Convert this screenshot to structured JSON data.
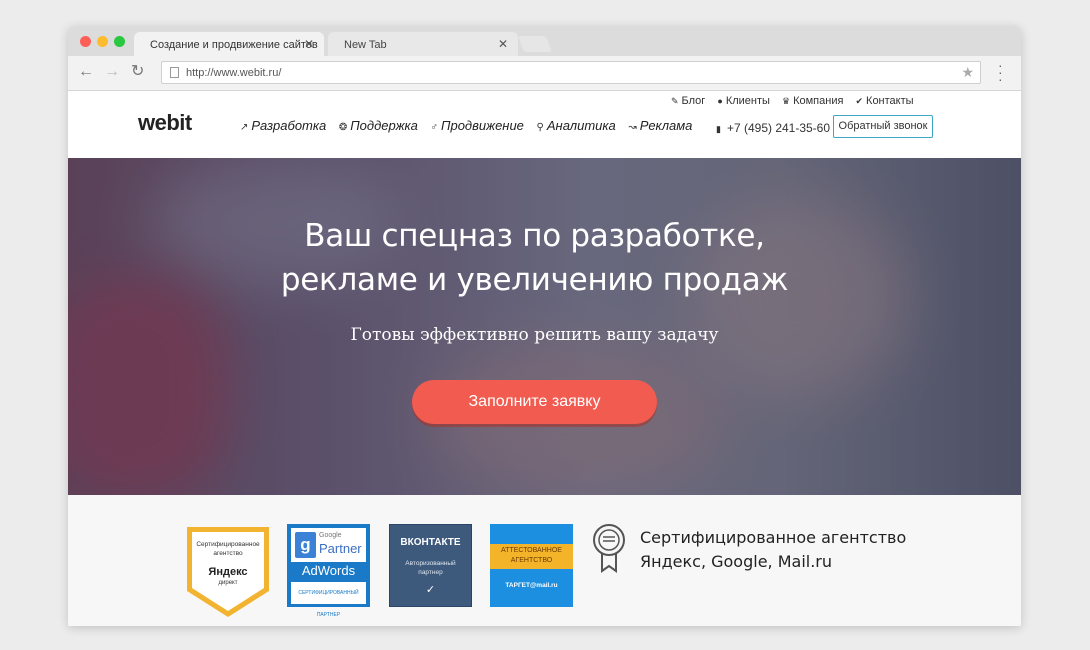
{
  "browser": {
    "tabs": [
      {
        "label": "Создание и продвижение сайтов",
        "active": true
      },
      {
        "label": "New Tab",
        "active": false
      }
    ],
    "url": "http://www.webit.ru/"
  },
  "header": {
    "logo": "webit",
    "main_nav": [
      {
        "label": "Разработка",
        "icon": "cursor-icon"
      },
      {
        "label": "Поддержка",
        "icon": "lifebuoy-icon"
      },
      {
        "label": "Продвижение",
        "icon": "rocket-icon"
      },
      {
        "label": "Аналитика",
        "icon": "magnifier-icon"
      },
      {
        "label": "Реклама",
        "icon": "trend-icon"
      }
    ],
    "top_nav": [
      {
        "label": "Блог",
        "icon": "pencil-icon"
      },
      {
        "label": "Клиенты",
        "icon": "user-icon"
      },
      {
        "label": "Компания",
        "icon": "crown-icon"
      },
      {
        "label": "Контакты",
        "icon": "check-icon"
      }
    ],
    "phone": "+7 (495) 241-35-60",
    "callback_label": "Обратный звонок"
  },
  "hero": {
    "title_line1": "Ваш спецназ по разработке,",
    "title_line2": "рекламе и увеличению продаж",
    "subtitle": "Готовы эффективно решить вашу задачу",
    "cta_label": "Заполните заявку"
  },
  "certs": {
    "yandex": {
      "line1": "Сертифицированное",
      "line2": "агентство",
      "brand": "Яндекс",
      "product": "директ"
    },
    "google": {
      "g": "g",
      "google": "Google",
      "partner": "Partner",
      "adwords": "AdWords",
      "cert_line1": "СЕРТИФИЦИРОВАННЫЙ",
      "cert_line2": "ПАРТНЕР"
    },
    "vk": {
      "title": "ВКОНТАКТЕ",
      "line1": "Авторизованный",
      "line2": "партнер",
      "check": "✓"
    },
    "mail": {
      "line1": "АТТЕСТОВАННОЕ",
      "line2": "АГЕНТСТВО",
      "brand": "ТАРГЕТ@mail.ru"
    },
    "text_line1": "Сертифицированное агентство",
    "text_line2": "Яндекс, Google, Mail.ru"
  },
  "colors": {
    "cta": "#f25c50",
    "callback_border": "#3fa6c8",
    "google_blue": "#1a7ac7",
    "vk_blue": "#3d5a7d",
    "mail_blue": "#1d8fe0",
    "mail_yellow": "#f4b42a"
  }
}
